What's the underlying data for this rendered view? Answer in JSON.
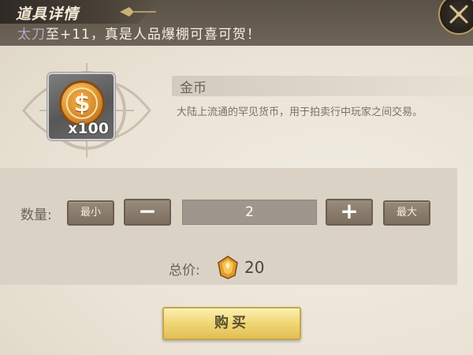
{
  "header": {
    "title": "道具详情",
    "banner_faded": "太刀",
    "banner_text": "至+11，真是人品爆棚可喜可贺！"
  },
  "item": {
    "icon": "gold-coin-icon",
    "quantity_badge": "x100",
    "name": "金币",
    "description": "大陆上流通的罕见货币，用于拍卖行中玩家之间交易。"
  },
  "purchase": {
    "qty_label": "数量:",
    "min_label": "最小",
    "minus_label": "−",
    "quantity": "2",
    "plus_label": "+",
    "max_label": "最大",
    "total_label": "总价:",
    "currency_icon": "amber-gem-icon",
    "total_value": "20",
    "buy_label": "购买"
  },
  "colors": {
    "header_bg": "#6e6457",
    "buy_button": "#f2d879",
    "panel_bg": "#ece6da"
  }
}
